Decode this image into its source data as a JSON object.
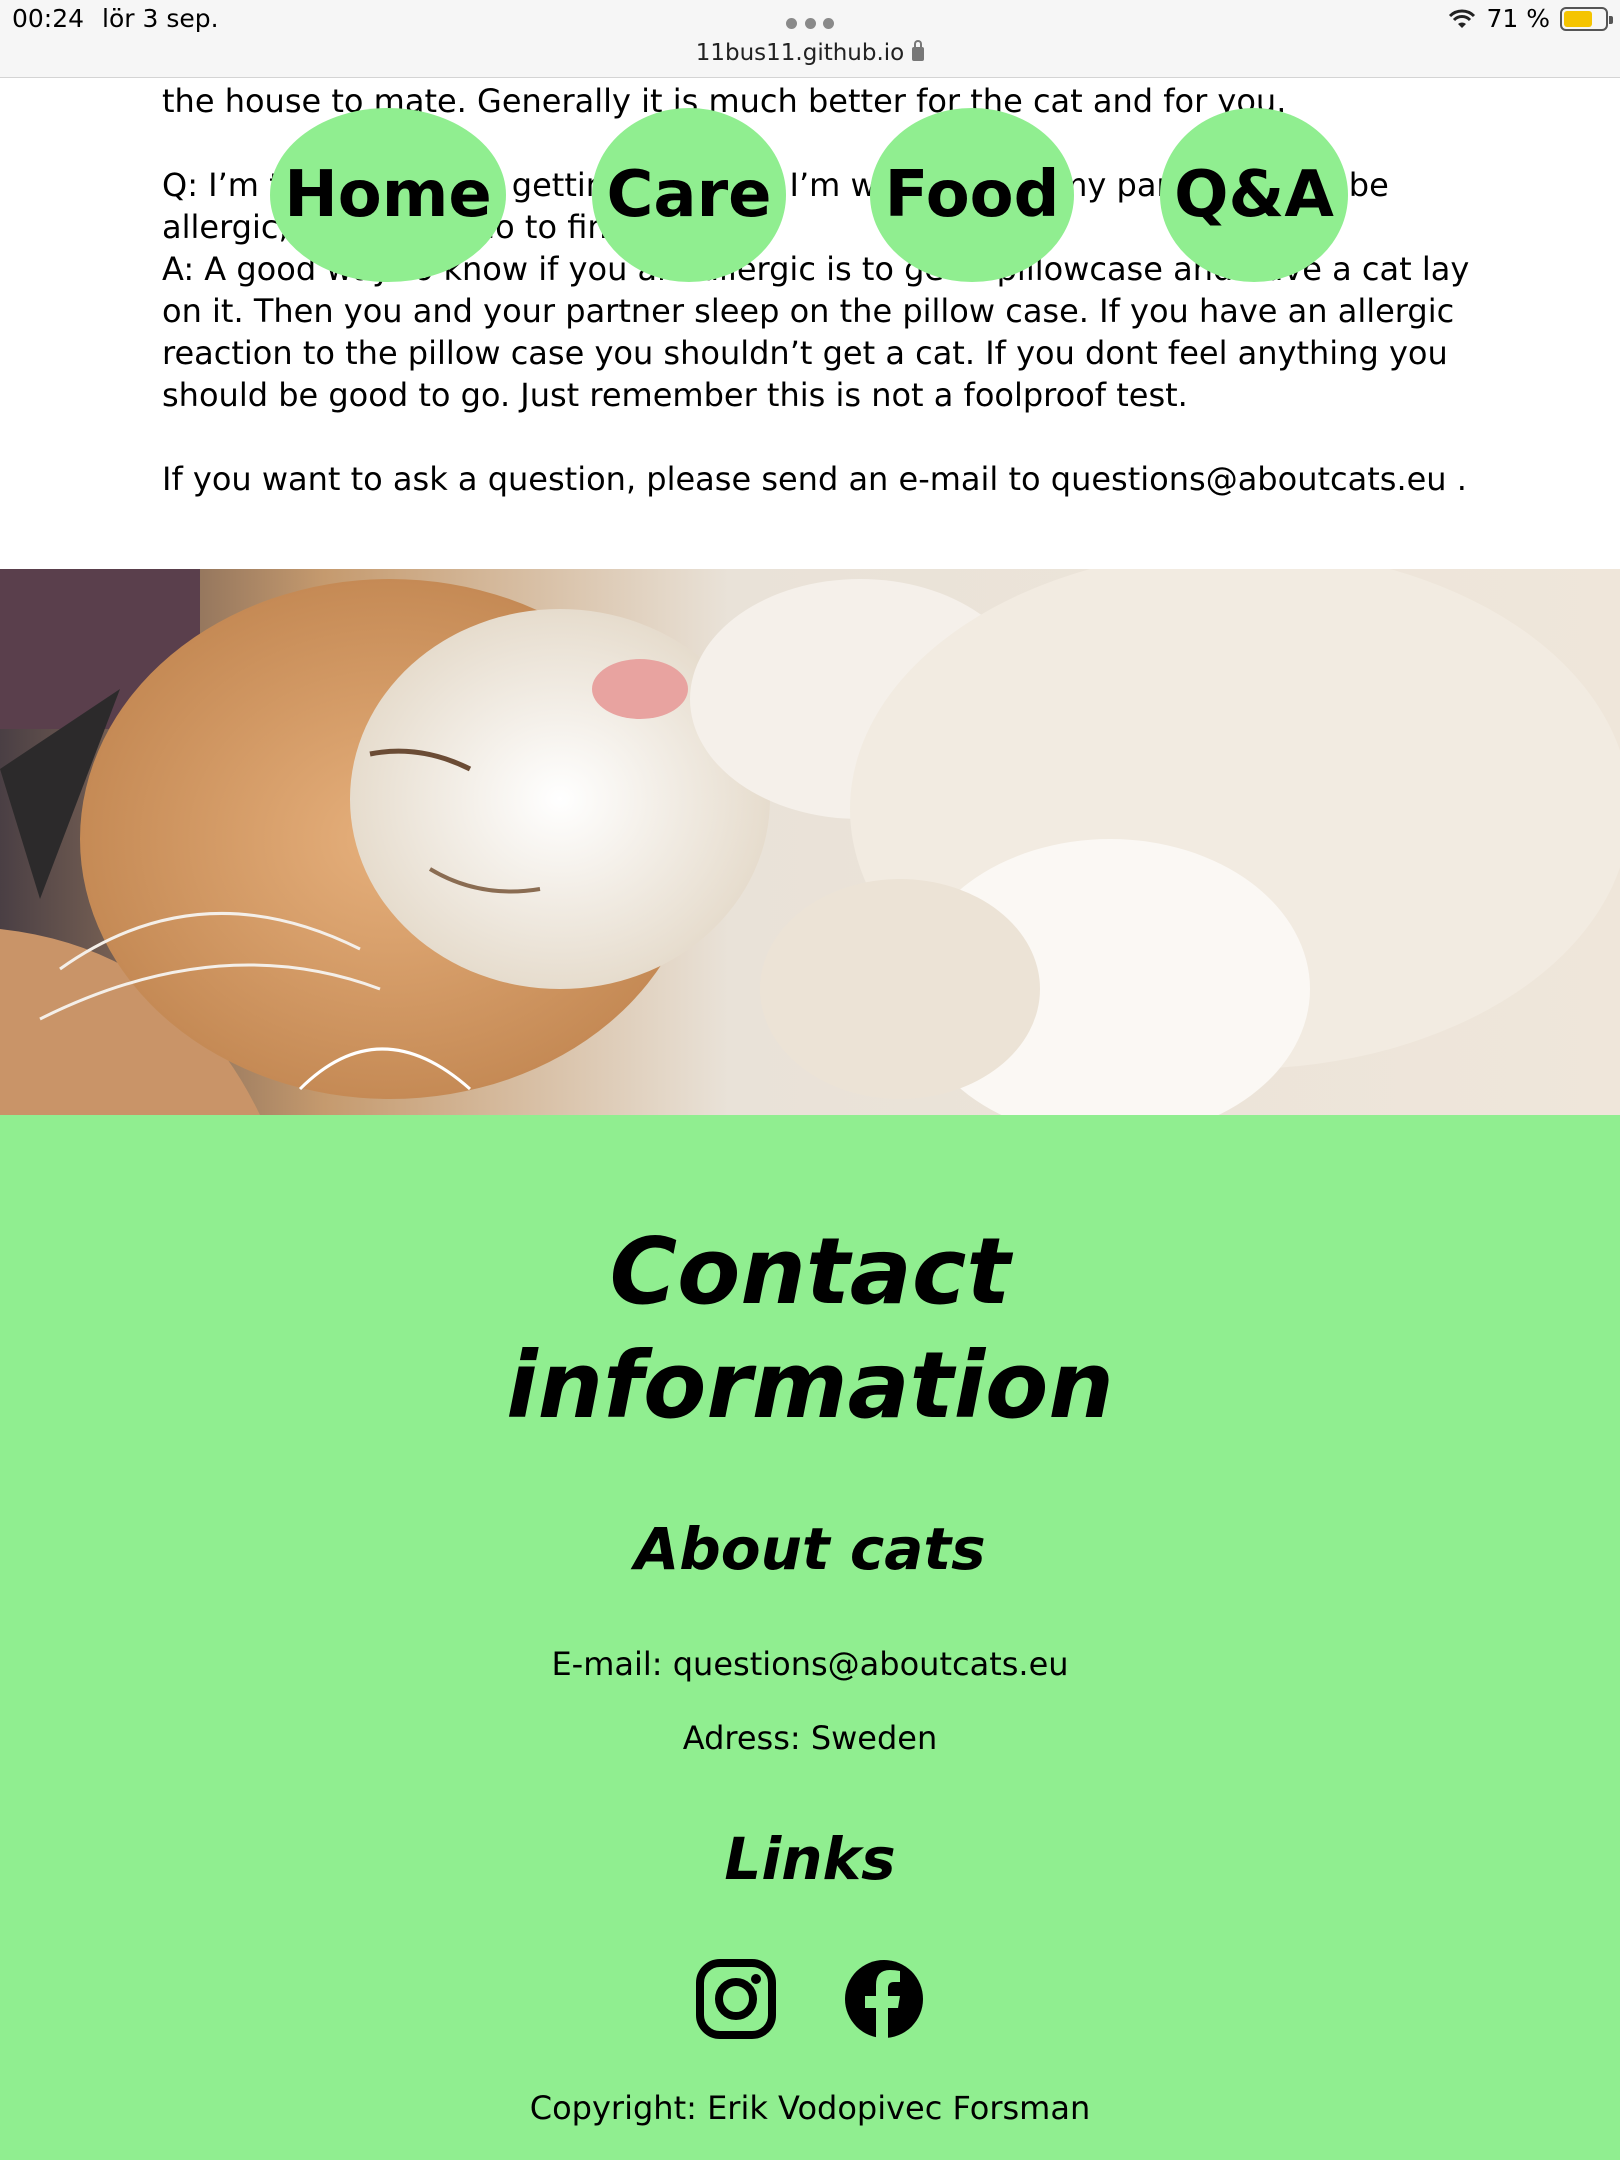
{
  "status_bar": {
    "time": "00:24",
    "date": "lör 3 sep.",
    "url": "11bus11.github.io",
    "battery": "71 %",
    "battery_level": 0.71
  },
  "nav": {
    "home": "Home",
    "care": "Care",
    "food": "Food",
    "qa": "Q&A"
  },
  "article": {
    "line_top": "the house to mate. Generally it is much better for the cat and for you.",
    "question": "Q: I’m thinking about getting a cat but I’m worried that my partner might be allergic, what can I do to find out?",
    "answer": "A: A good way to know if you are allergic is to get a pillowcase and have a cat lay on it. Then you and your partner sleep on the pillow case. If you have an allergic reaction to the pillow case you shouldn’t get a cat. If you dont feel anything you should be good to go. Just remember this is not a foolproof test.",
    "ask": "If you want to ask a question, please send an e-mail to questions@aboutcats.eu .",
    "colors": {
      "nav_bg": "#90ee90",
      "footer_bg": "#90ee90"
    }
  },
  "footer": {
    "title": "Contact information",
    "about_heading": "About cats",
    "email": "E-mail: questions@aboutcats.eu",
    "address": "Adress: Sweden",
    "links_heading": "Links",
    "icons": [
      "instagram-icon",
      "facebook-icon"
    ],
    "copyright": "Copyright: Erik Vodopivec Forsman"
  }
}
